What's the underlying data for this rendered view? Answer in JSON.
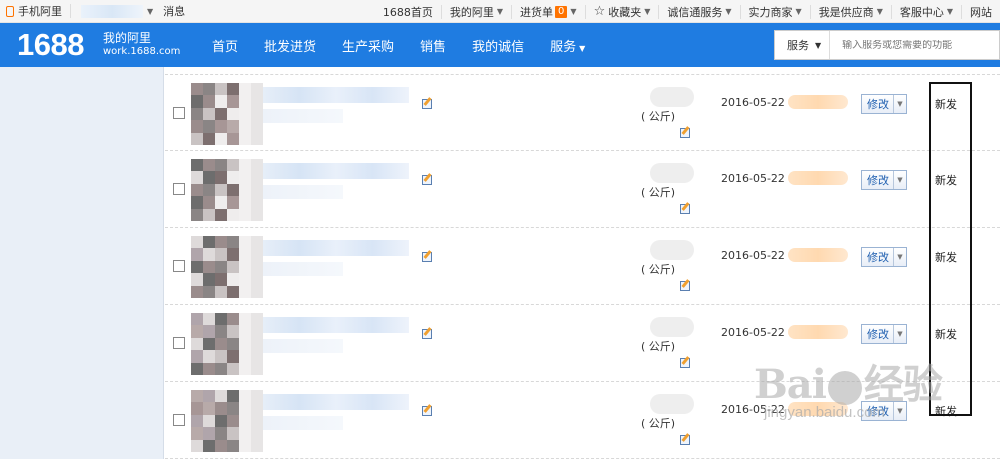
{
  "topbar": {
    "mobile_label": "手机阿里",
    "messages_label": "消息",
    "links": [
      {
        "label": "1688首页",
        "has_caret": false
      },
      {
        "label": "我的阿里",
        "has_caret": true
      },
      {
        "label": "进货单",
        "badge": "0",
        "has_caret": true
      },
      {
        "label": "收藏夹",
        "icon": "star-icon",
        "has_caret": true
      },
      {
        "label": "诚信通服务",
        "has_caret": true
      },
      {
        "label": "实力商家",
        "has_caret": true
      },
      {
        "label": "我是供应商",
        "has_caret": true
      },
      {
        "label": "客服中心",
        "has_caret": true
      },
      {
        "label": "网站",
        "has_caret": false
      }
    ]
  },
  "header": {
    "logo": "1688",
    "site_title": "我的阿里",
    "site_subtitle": "work.1688.com",
    "nav": [
      {
        "label": "首页"
      },
      {
        "label": "批发进货"
      },
      {
        "label": "生产采购"
      },
      {
        "label": "销售"
      },
      {
        "label": "我的诚信"
      },
      {
        "label": "服务",
        "has_caret": true
      }
    ],
    "search": {
      "scope": "服务",
      "placeholder": "输入服务或您需要的功能"
    },
    "accent_color": "#1f7ce1"
  },
  "rows": [
    {
      "qty_text": "(     公斤)",
      "date": "2016-05-22",
      "modify_label": "修改",
      "action_label": "新发"
    },
    {
      "qty_text": "(     公斤)",
      "date": "2016-05-22",
      "modify_label": "修改",
      "action_label": "新发"
    },
    {
      "qty_text": "(     公斤)",
      "date": "2016-05-22",
      "modify_label": "修改",
      "action_label": "新发"
    },
    {
      "qty_text": "(     公斤)",
      "date": "2016-05-22",
      "modify_label": "修改",
      "action_label": "新发"
    },
    {
      "qty_text": "(     公斤)",
      "date": "2016-05-22",
      "modify_label": "修改",
      "action_label": "新发"
    }
  ],
  "watermark": {
    "main": "Bai",
    "main2": "经验",
    "sub": "jingyan.baidu.com"
  }
}
